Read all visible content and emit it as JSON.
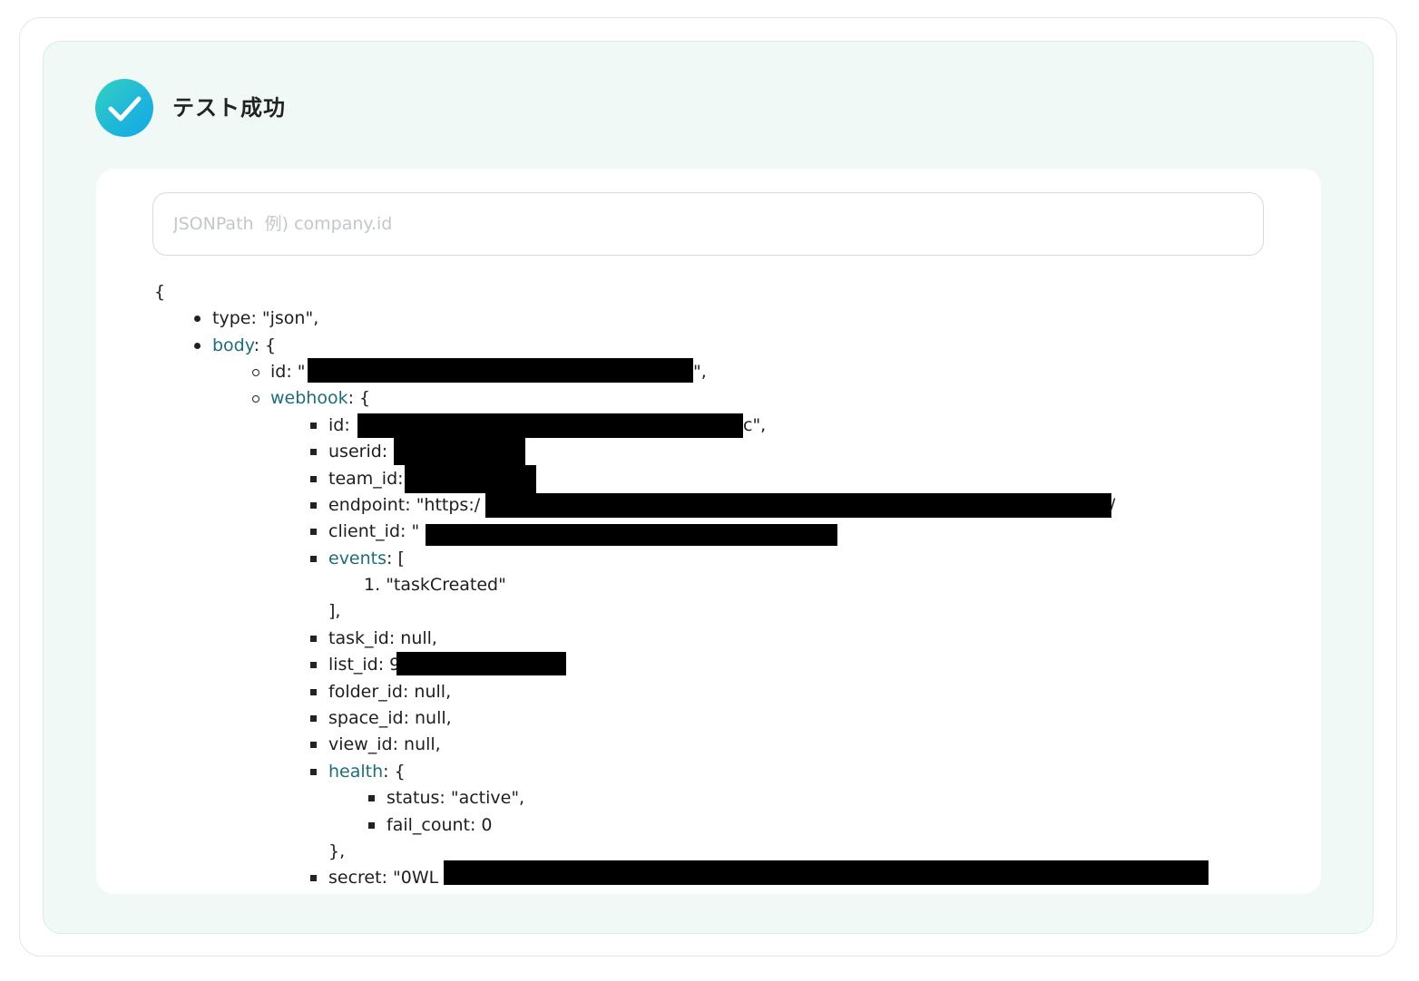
{
  "result": {
    "title": "テスト成功",
    "status_icon": "check-icon"
  },
  "search": {
    "placeholder": "JSONPath  例) company.id",
    "value": ""
  },
  "json_tree": {
    "open_brace": "{",
    "type_line": "type: \"json\",",
    "body_key": "body",
    "body_suffix": ": {",
    "body_id_prefix": "id: \"",
    "body_id_suffix": "\",",
    "webhook_key": "webhook",
    "webhook_suffix": ": {",
    "wh_id_prefix": "id: ",
    "wh_id_suffix": "c\",",
    "userid_prefix": "userid: ",
    "team_id_prefix": "team_id: ",
    "endpoint_prefix": "endpoint: \"https:/",
    "endpoint_suffix": "/",
    "client_id_prefix": "client_id: \"",
    "events_key": "events",
    "events_suffix": ": [",
    "events_item_number": "1.",
    "events_item_value": "\"taskCreated\"",
    "events_close": "],",
    "task_id_line": "task_id: null,",
    "list_id_prefix": "list_id: 9",
    "folder_id_line": "folder_id: null,",
    "space_id_line": "space_id: null,",
    "view_id_line": "view_id: null,",
    "health_key": "health",
    "health_suffix": ": {",
    "status_line": "status: \"active\",",
    "fail_count_line": "fail_count: 0",
    "health_close": "},",
    "secret_prefix": "secret: \"0WL"
  }
}
